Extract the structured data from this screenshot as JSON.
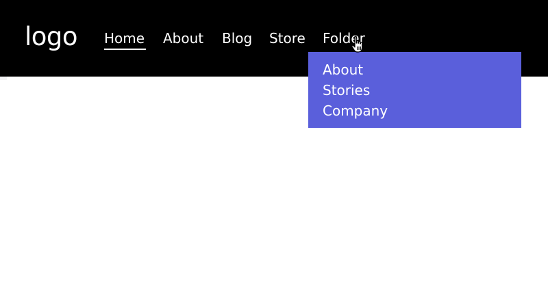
{
  "header": {
    "logo": "logo",
    "nav": {
      "home": "Home",
      "about": "About",
      "blog": "Blog",
      "store": "Store",
      "folder": "Folder"
    },
    "active_item": "Home"
  },
  "dropdown": {
    "items": [
      "About",
      "Stories",
      "Company"
    ]
  },
  "colors": {
    "header_bg": "#000000",
    "dropdown_bg": "#5a5fdb",
    "text": "#ffffff"
  },
  "icons": {
    "cursor": "hand-pointer-icon"
  }
}
